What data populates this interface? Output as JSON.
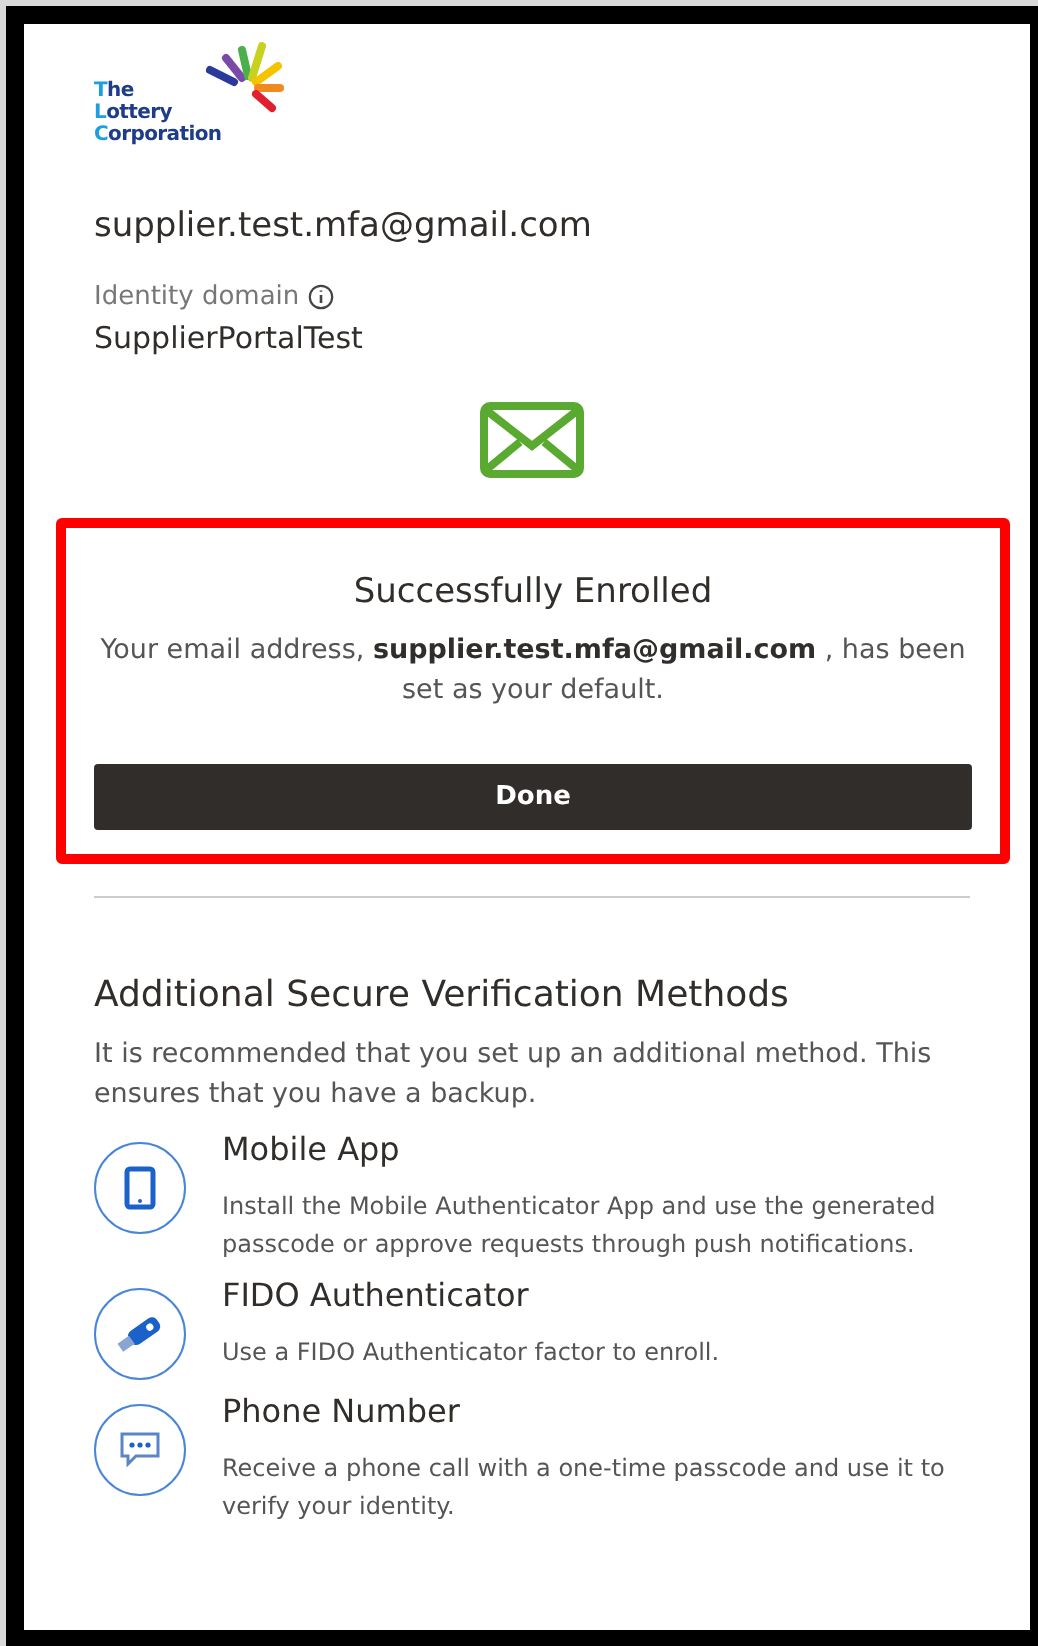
{
  "logo": {
    "lines": [
      "The",
      "Lottery",
      "Corporation"
    ]
  },
  "user": {
    "email": "supplier.test.mfa@gmail.com",
    "domain_label": "Identity domain",
    "domain_value": "SupplierPortalTest"
  },
  "confirmation": {
    "title": "Successfully Enrolled",
    "message": "Your email address, **supplier.test.mfa@gmail.com** , has been set as your default.",
    "button": "Done"
  },
  "additional": {
    "title": "Additional Secure Verification Methods",
    "description": "It is recommended that you set up an additional method. This ensures that you have a backup.",
    "methods": [
      {
        "kind": "mobile",
        "title": "Mobile App",
        "description": "Install the Mobile Authenticator App and use the generated passcode or approve requests through push notifications."
      },
      {
        "kind": "fido",
        "title": "FIDO Authenticator",
        "description": "Use a FIDO Authenticator factor to enroll."
      },
      {
        "kind": "phone",
        "title": "Phone Number",
        "description": "Receive a phone call with a one-time passcode and use it to verify your identity."
      }
    ]
  }
}
